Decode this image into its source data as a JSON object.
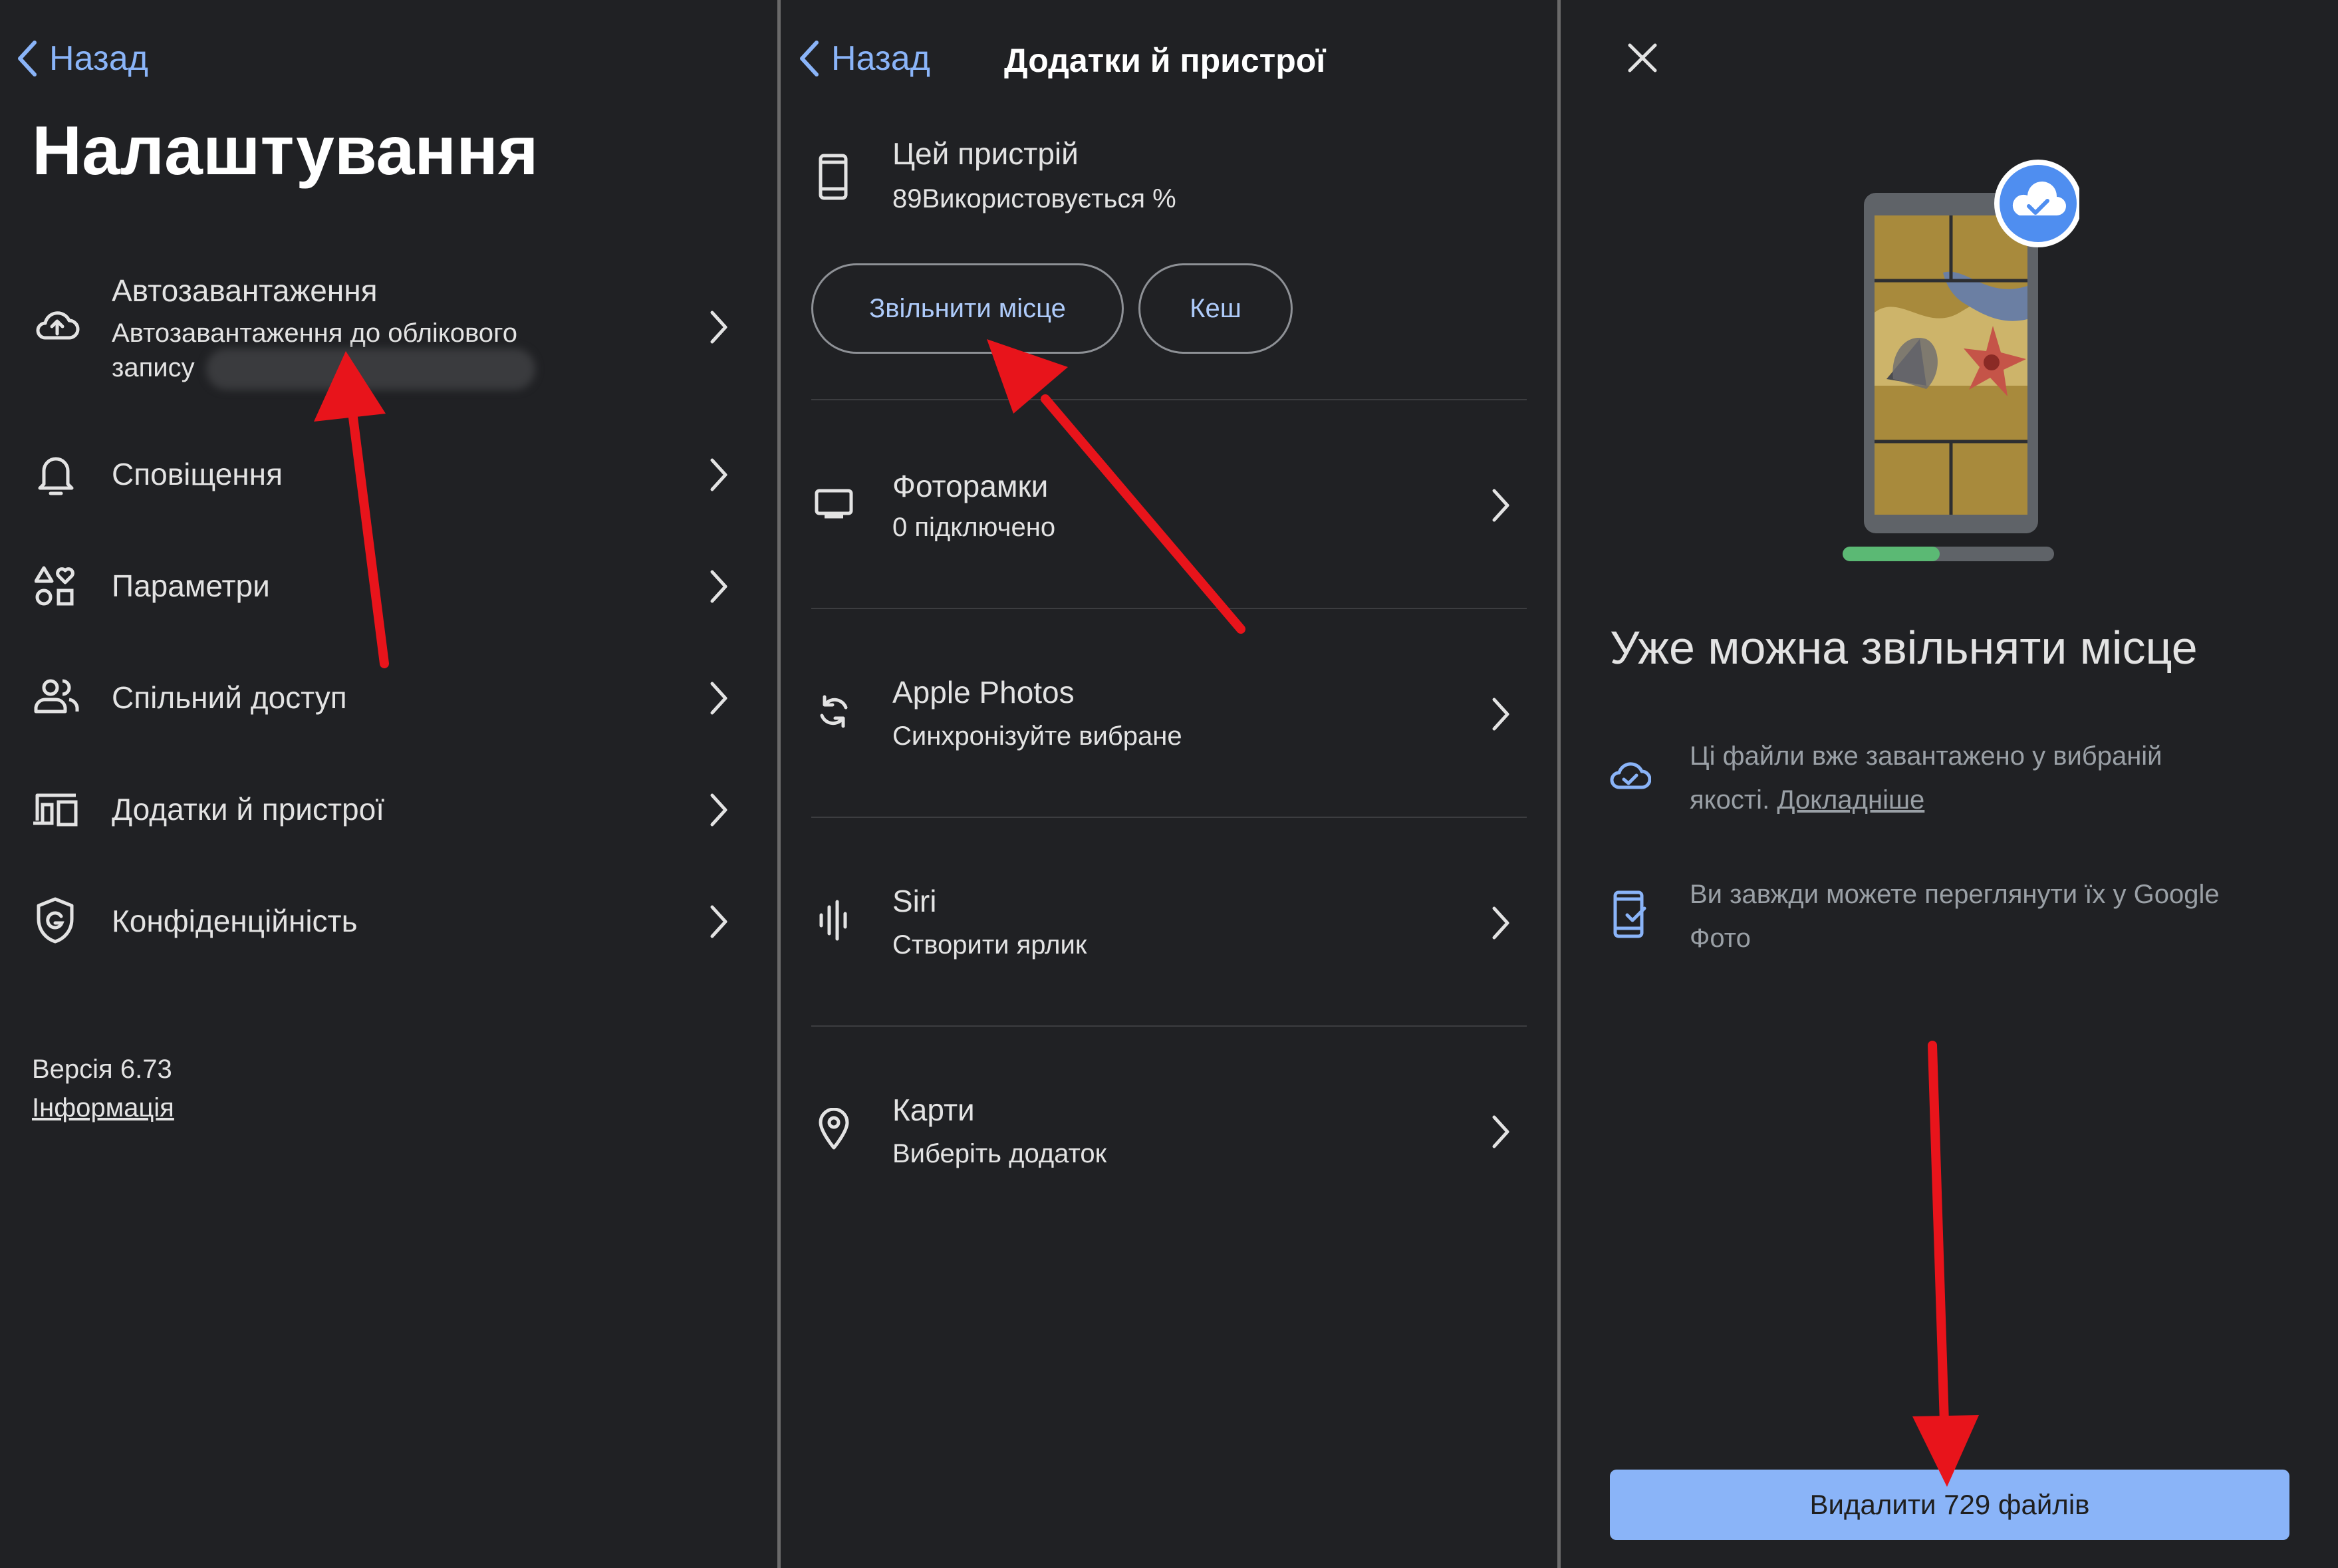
{
  "panel1": {
    "back_label": "Назад",
    "title": "Налаштування",
    "items": [
      {
        "title": "Автозавантаження",
        "subtitle_line1": "Автозавантаження до облікового",
        "subtitle_line2": "запису"
      },
      {
        "title": "Сповіщення"
      },
      {
        "title": "Параметри"
      },
      {
        "title": "Спільний доступ"
      },
      {
        "title": "Додатки й пристрої"
      },
      {
        "title": "Конфіденційність"
      }
    ],
    "version": "Версія 6.73",
    "info_link": "Інформація"
  },
  "panel2": {
    "back_label": "Назад",
    "header_title": "Додатки й пристрої",
    "device": {
      "title": "Цей пристрій",
      "subtitle": "89Використовується %"
    },
    "buttons": {
      "free_space": "Звільнити місце",
      "cache": "Кеш"
    },
    "items": [
      {
        "title": "Фоторамки",
        "subtitle": "0 підключено",
        "icon": "tv-frame-icon"
      },
      {
        "title": "Apple Photos",
        "subtitle": "Синхронізуйте вибране",
        "icon": "sync-icon"
      },
      {
        "title": "Siri",
        "subtitle": "Створити ярлик",
        "icon": "voice-wave-icon"
      },
      {
        "title": "Карти",
        "subtitle": "Виберіть додаток",
        "icon": "location-pin-icon"
      }
    ]
  },
  "panel3": {
    "heading": "Уже можна звільняти місце",
    "info1_text": "Ці файли вже завантажено у вибраній якості.",
    "info1_link": "Докладніше",
    "info1_line1": "Ці файли вже завантажено у вибраній",
    "info1_line2_prefix": "якості.",
    "info2_line1": "Ви завжди можете переглянути їх у Google",
    "info2_line2": "Фото",
    "cta_label": "Видалити 729 файлів",
    "progress": 0.46
  },
  "colors": {
    "background": "#202124",
    "accent": "#8ab4f8",
    "annotation_arrow": "#e8141b",
    "progress_green": "#5bb974"
  }
}
